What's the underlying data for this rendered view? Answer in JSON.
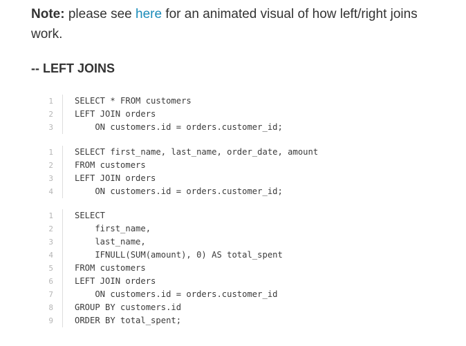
{
  "note": {
    "label": "Note:",
    "text_before": " please see ",
    "link": "here",
    "text_after": " for an animated visual of how left/right joins work."
  },
  "heading": "-- LEFT JOINS",
  "code_blocks": [
    {
      "lines": [
        {
          "n": "1",
          "code": "SELECT * FROM customers"
        },
        {
          "n": "2",
          "code": "LEFT JOIN orders"
        },
        {
          "n": "3",
          "code": "    ON customers.id = orders.customer_id;"
        }
      ]
    },
    {
      "lines": [
        {
          "n": "1",
          "code": "SELECT first_name, last_name, order_date, amount"
        },
        {
          "n": "2",
          "code": "FROM customers"
        },
        {
          "n": "3",
          "code": "LEFT JOIN orders"
        },
        {
          "n": "4",
          "code": "    ON customers.id = orders.customer_id;"
        }
      ]
    },
    {
      "lines": [
        {
          "n": "1",
          "code": "SELECT"
        },
        {
          "n": "2",
          "code": "    first_name,"
        },
        {
          "n": "3",
          "code": "    last_name,"
        },
        {
          "n": "4",
          "code": "    IFNULL(SUM(amount), 0) AS total_spent"
        },
        {
          "n": "5",
          "code": "FROM customers"
        },
        {
          "n": "6",
          "code": "LEFT JOIN orders"
        },
        {
          "n": "7",
          "code": "    ON customers.id = orders.customer_id"
        },
        {
          "n": "8",
          "code": "GROUP BY customers.id"
        },
        {
          "n": "9",
          "code": "ORDER BY total_spent;"
        }
      ]
    }
  ]
}
